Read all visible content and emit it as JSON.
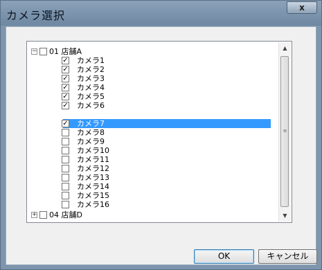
{
  "window": {
    "title": "カメラ選択",
    "close_label": "x"
  },
  "tree": {
    "store_a": {
      "expander": "−",
      "checked": "",
      "label": "01 店舗A"
    },
    "cameras": [
      {
        "checked": "✓",
        "label": "カメラ1"
      },
      {
        "checked": "✓",
        "label": "カメラ2"
      },
      {
        "checked": "✓",
        "label": "カメラ3"
      },
      {
        "checked": "✓",
        "label": "カメラ4"
      },
      {
        "checked": "✓",
        "label": "カメラ5"
      },
      {
        "checked": "✓",
        "label": "カメラ6"
      },
      {
        "checked": "✓",
        "label": "カメラ7",
        "selected": true
      },
      {
        "checked": "",
        "label": "カメラ8"
      },
      {
        "checked": "",
        "label": "カメラ9"
      },
      {
        "checked": "",
        "label": "カメラ10"
      },
      {
        "checked": "",
        "label": "カメラ11"
      },
      {
        "checked": "",
        "label": "カメラ12"
      },
      {
        "checked": "",
        "label": "カメラ13"
      },
      {
        "checked": "",
        "label": "カメラ14"
      },
      {
        "checked": "",
        "label": "カメラ15"
      },
      {
        "checked": "",
        "label": "カメラ16"
      }
    ],
    "store_d": {
      "expander": "+",
      "checked": "",
      "label": "04 店舗D"
    },
    "scroll": {
      "up": "▲",
      "down": "▼",
      "grip": "≡"
    }
  },
  "buttons": {
    "ok": "OK",
    "cancel": "キャンセル"
  }
}
